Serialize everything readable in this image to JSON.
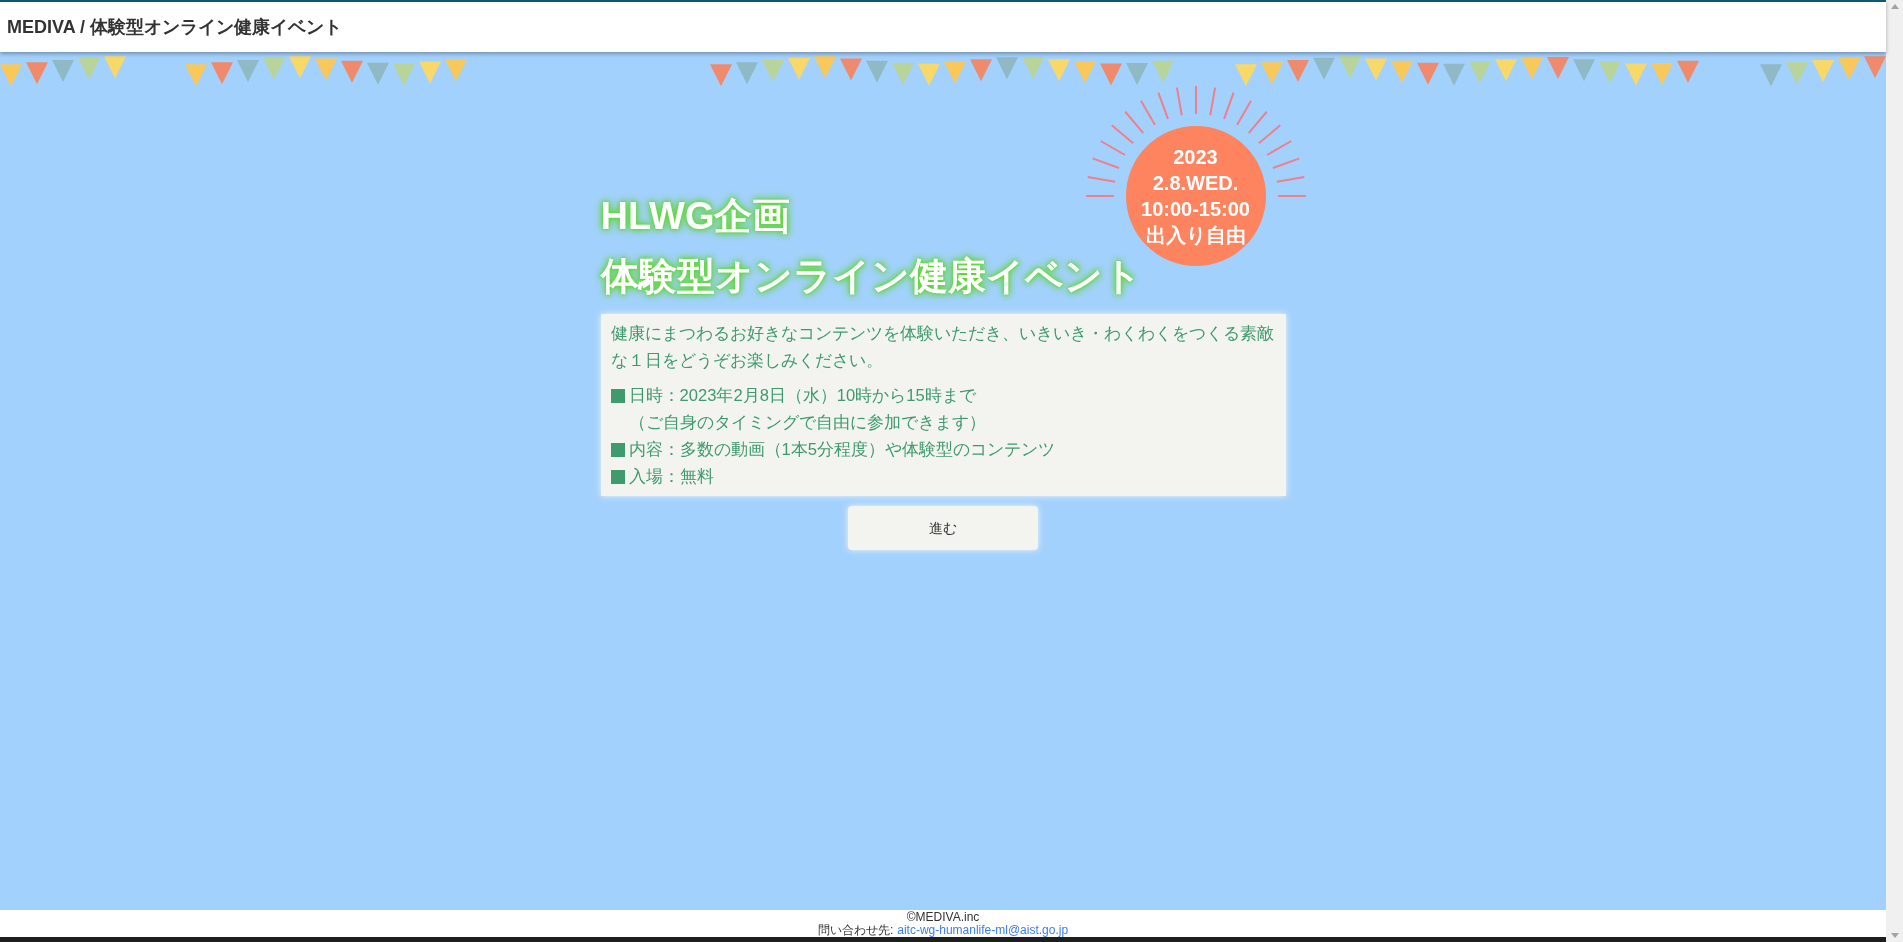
{
  "header": {
    "title": "MEDIVA / 体験型オンライン健康イベント"
  },
  "badge": {
    "lines": [
      "2023",
      "2.8.WED.",
      "10:00-15:00",
      "出入り自由"
    ]
  },
  "title_lines": [
    "HLWG企画",
    "体験型オンライン健康イベント"
  ],
  "info": {
    "intro": "健康にまつわるお好きなコンテンツを体験いただき、いきいき・わくわくをつくる素敵な１日をどうぞお楽しみください。",
    "items": [
      {
        "text": "日時：2023年2月8日（水）10時から15時まで",
        "note": "（ご自身のタイミングで自由に参加できます）"
      },
      {
        "text": "内容：多数の動画（1本5分程度）や体験型のコンテンツ"
      },
      {
        "text": "入場：無料"
      }
    ]
  },
  "button": "進む",
  "footer": {
    "copyright": "©MEDIVA.inc",
    "contact_label": "問い合わせ先:",
    "email": "aitc-wg-humanlife-ml@aist.go.jp"
  }
}
